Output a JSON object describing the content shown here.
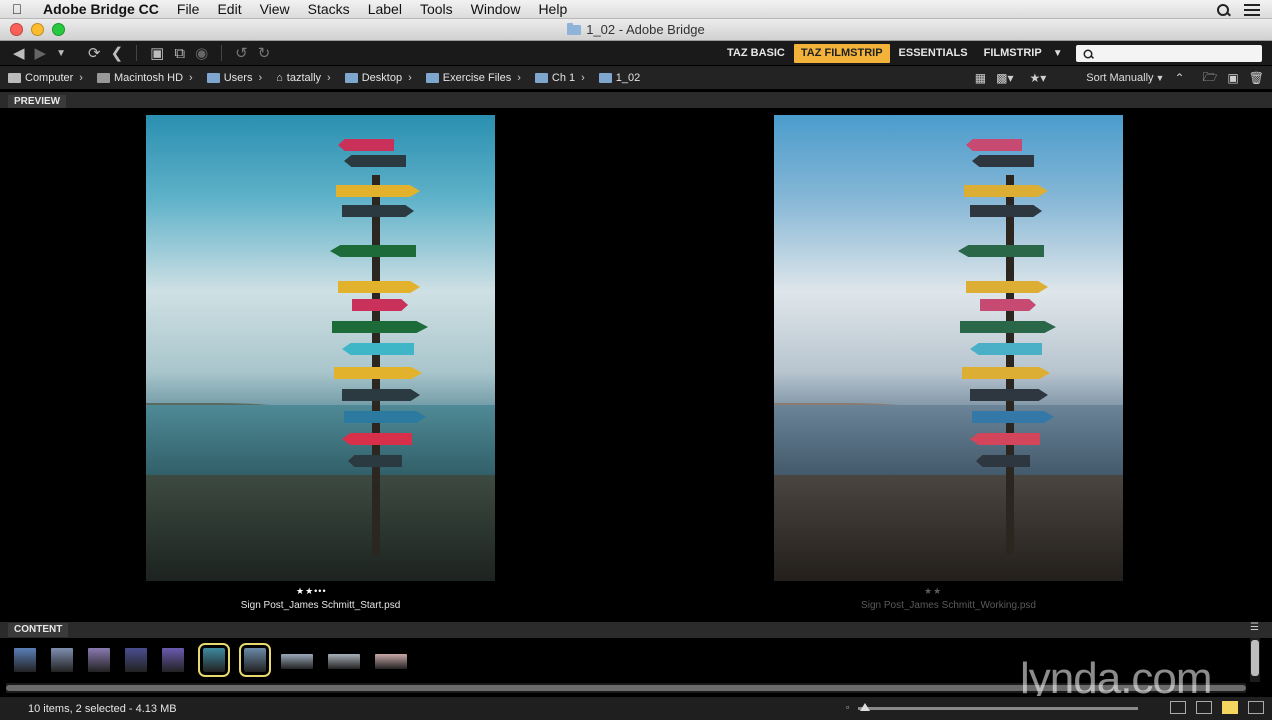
{
  "menubar": {
    "app_name": "Adobe Bridge CC",
    "items": [
      "File",
      "Edit",
      "View",
      "Stacks",
      "Label",
      "Tools",
      "Window",
      "Help"
    ]
  },
  "window": {
    "title": "1_02 - Adobe Bridge"
  },
  "workspaces": {
    "tabs": [
      {
        "label": "TAZ BASIC",
        "active": false
      },
      {
        "label": "TAZ FILMSTRIP",
        "active": true
      },
      {
        "label": "ESSENTIALS",
        "active": false
      },
      {
        "label": "FILMSTRIP",
        "active": false
      }
    ],
    "search_placeholder": ""
  },
  "path": {
    "crumbs": [
      "Computer",
      "Macintosh HD",
      "Users",
      "taztally",
      "Desktop",
      "Exercise Files",
      "Ch 1",
      "1_02"
    ],
    "sort_label": "Sort Manually"
  },
  "preview": {
    "panel_label": "PREVIEW",
    "images": [
      {
        "filename": "Sign Post_James Schmitt_Start.psd",
        "stars": "★★•••",
        "selected": true
      },
      {
        "filename": "Sign Post_James Schmitt_Working.psd",
        "stars": "★★",
        "selected": false
      }
    ]
  },
  "content": {
    "panel_label": "CONTENT",
    "thumbnails": [
      {
        "name": "portrait-1",
        "selected": false,
        "color": "#5b7fb8"
      },
      {
        "name": "portrait-2",
        "selected": false,
        "color": "#7f8fb0"
      },
      {
        "name": "purple-1",
        "selected": false,
        "color": "#8a7ab0"
      },
      {
        "name": "purple-2",
        "selected": false,
        "color": "#4a4e90"
      },
      {
        "name": "purple-3",
        "selected": false,
        "color": "#6a5ab0"
      },
      {
        "name": "signpost-start",
        "selected": true,
        "color": "#3f8aa0"
      },
      {
        "name": "signpost-working",
        "selected": true,
        "color": "#6a8aa8"
      },
      {
        "name": "landscape-1",
        "selected": false,
        "color": "#9aa8b8"
      },
      {
        "name": "landscape-2",
        "selected": false,
        "color": "#a8b0b8"
      },
      {
        "name": "landscape-3",
        "selected": false,
        "color": "#c8a8a8"
      }
    ]
  },
  "status": {
    "text": "10 items, 2 selected - 4.13 MB"
  },
  "watermark": "lynda.com",
  "colors": {
    "accent": "#f3b33a",
    "selection": "#e8d870"
  }
}
